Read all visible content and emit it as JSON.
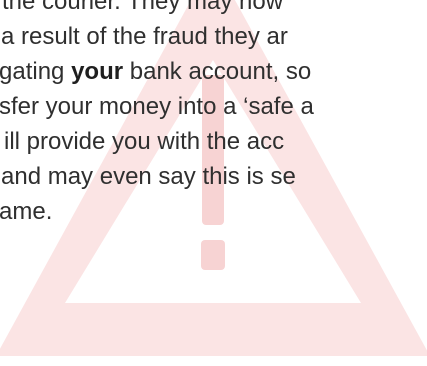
{
  "document": {
    "lines": [
      {
        "text": "the courier. They may now"
      },
      {
        "text": "a result of the fraud they ar"
      },
      {
        "prefix": "gating ",
        "emphasis": "your",
        "suffix": " bank account, so"
      },
      {
        "text": "sfer your money into a ‘safe a"
      },
      {
        "text": "ill provide you with the acc"
      },
      {
        "text": "and may even say this is se"
      },
      {
        "text": "ame."
      }
    ]
  },
  "graphic": {
    "name": "warning-triangle",
    "color": "#fbe4e4",
    "mark_color": "#f7d3d3"
  }
}
